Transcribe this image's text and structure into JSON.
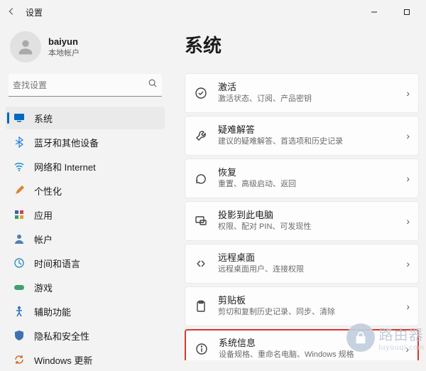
{
  "window": {
    "title": "设置"
  },
  "user": {
    "name": "baiyun",
    "type": "本地帐户"
  },
  "search": {
    "placeholder": "查找设置"
  },
  "nav": {
    "items": [
      {
        "label": "系统"
      },
      {
        "label": "蓝牙和其他设备"
      },
      {
        "label": "网络和 Internet"
      },
      {
        "label": "个性化"
      },
      {
        "label": "应用"
      },
      {
        "label": "帐户"
      },
      {
        "label": "时间和语言"
      },
      {
        "label": "游戏"
      },
      {
        "label": "辅助功能"
      },
      {
        "label": "隐私和安全性"
      },
      {
        "label": "Windows 更新"
      }
    ]
  },
  "page": {
    "title": "系统"
  },
  "cards": [
    {
      "title": "激活",
      "sub": "激活状态、订阅、产品密钥"
    },
    {
      "title": "疑难解答",
      "sub": "建议的疑难解答、首选项和历史记录"
    },
    {
      "title": "恢复",
      "sub": "重置、高级启动、返回"
    },
    {
      "title": "投影到此电脑",
      "sub": "权限、配对 PIN、可发现性"
    },
    {
      "title": "远程桌面",
      "sub": "远程桌面用户、连接权限"
    },
    {
      "title": "剪贴板",
      "sub": "剪切和复制历史记录、同步、清除"
    },
    {
      "title": "系统信息",
      "sub": "设备规格、重命名电脑、Windows 规格"
    }
  ],
  "watermark": {
    "title": "路由器",
    "domain": "luyouqi.com"
  }
}
